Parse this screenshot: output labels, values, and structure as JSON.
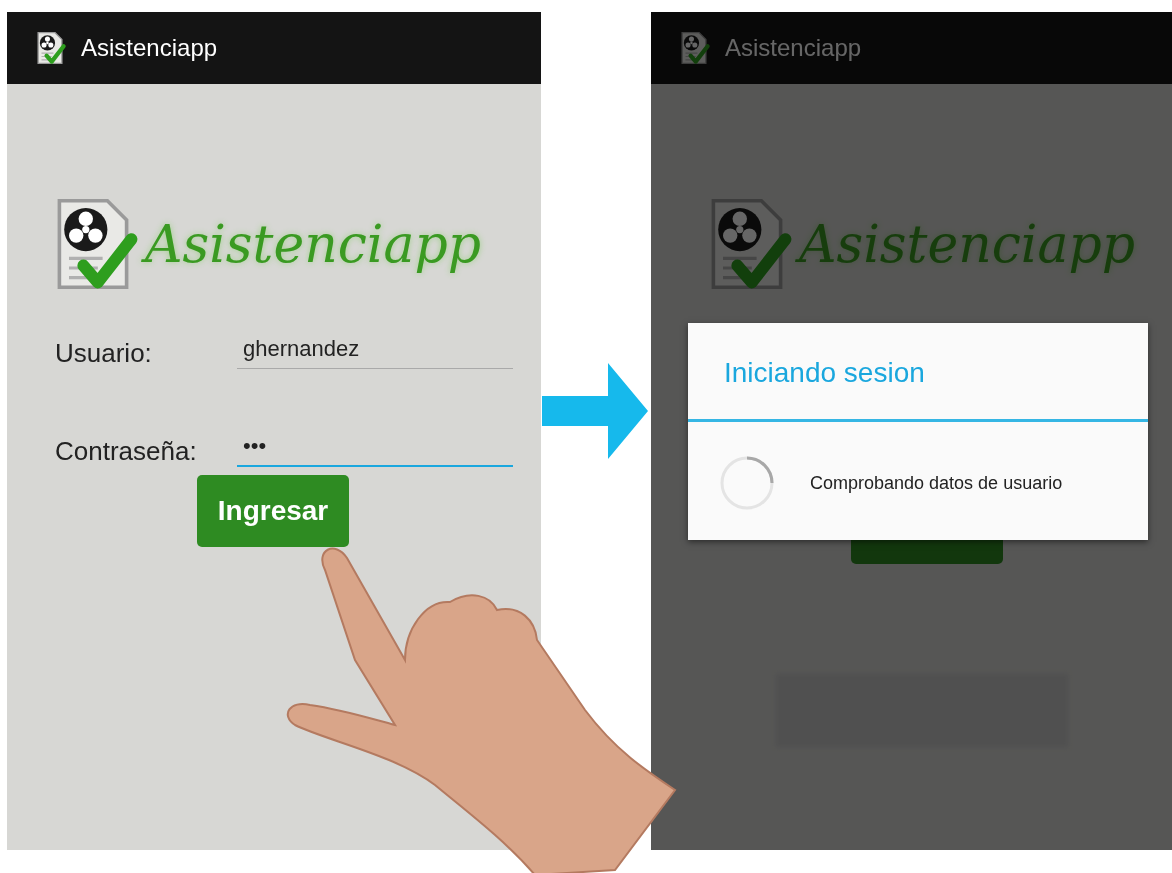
{
  "screens": [
    {
      "kind": "login",
      "app_bar": {
        "title": "Asistenciapp"
      },
      "logo": {
        "text": "Asistenciapp"
      },
      "fields": [
        {
          "label": "Usuario:",
          "value": "ghernandez",
          "focused": false
        },
        {
          "label": "Contraseña:",
          "value": "•••",
          "focused": true
        }
      ],
      "button": {
        "label": "Ingresar"
      }
    },
    {
      "kind": "progress",
      "app_bar": {
        "title": "Asistenciapp"
      },
      "logo": {
        "text": "Asistenciapp"
      },
      "dialog": {
        "title": "Iniciando sesion",
        "message": "Comprobando datos de usuario"
      }
    }
  ]
}
